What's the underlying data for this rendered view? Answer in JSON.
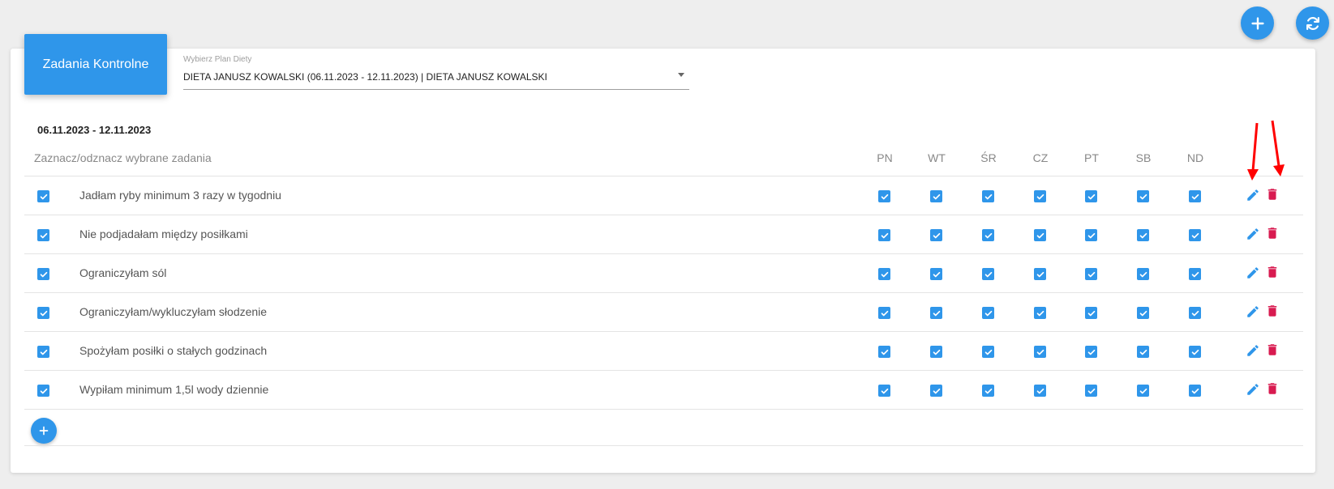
{
  "toolbar": {
    "add_icon": "plus-icon",
    "sync_icon": "sync-icon"
  },
  "header": {
    "title": "Zadania Kontrolne"
  },
  "plan_select": {
    "label": "Wybierz Plan Diety",
    "value": "DIETA JANUSZ KOWALSKI (06.11.2023 - 12.11.2023) | DIETA JANUSZ KOWALSKI"
  },
  "week": {
    "range": "06.11.2023 - 12.11.2023"
  },
  "table": {
    "tasks_header": "Zaznacz/odznacz wybrane zadania",
    "days": [
      "PN",
      "WT",
      "ŚR",
      "CZ",
      "PT",
      "SB",
      "ND"
    ],
    "rows": [
      {
        "label": "Jadłam ryby minimum 3 razy w tygodniu",
        "checked": true,
        "days": [
          true,
          true,
          true,
          true,
          true,
          true,
          true
        ]
      },
      {
        "label": "Nie podjadałam między posiłkami",
        "checked": true,
        "days": [
          true,
          true,
          true,
          true,
          true,
          true,
          true
        ]
      },
      {
        "label": "Ograniczyłam sól",
        "checked": true,
        "days": [
          true,
          true,
          true,
          true,
          true,
          true,
          true
        ]
      },
      {
        "label": "Ograniczyłam/wykluczyłam słodzenie",
        "checked": true,
        "days": [
          true,
          true,
          true,
          true,
          true,
          true,
          true
        ]
      },
      {
        "label": "Spożyłam posiłki o stałych godzinach",
        "checked": true,
        "days": [
          true,
          true,
          true,
          true,
          true,
          true,
          true
        ]
      },
      {
        "label": "Wypiłam minimum 1,5l wody dziennie",
        "checked": true,
        "days": [
          true,
          true,
          true,
          true,
          true,
          true,
          true
        ]
      }
    ]
  },
  "colors": {
    "accent": "#2f96ea",
    "delete": "#d81b50",
    "annotation": "#ff0000"
  },
  "icons": {
    "edit": "pencil-icon",
    "delete": "trash-icon",
    "add_task": "plus-icon"
  }
}
